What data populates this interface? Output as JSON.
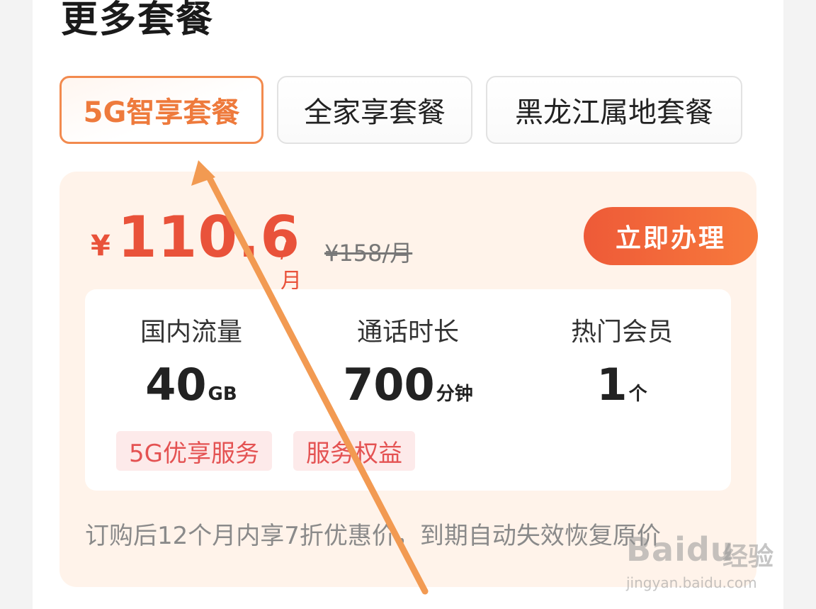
{
  "section": {
    "title": "更多套餐"
  },
  "tabs": [
    {
      "label": "5G智享套餐",
      "active": true
    },
    {
      "label": "全家享套餐",
      "active": false
    },
    {
      "label": "黑龙江属地套餐",
      "active": false
    }
  ],
  "plan": {
    "currency": "¥",
    "price": "110.6",
    "per_month": "/月",
    "original_price": "¥158/月",
    "apply_label": "立即办理",
    "stats": [
      {
        "label": "国内流量",
        "value": "40",
        "unit": "GB"
      },
      {
        "label": "通话时长",
        "value": "700",
        "unit": "分钟"
      },
      {
        "label": "热门会员",
        "value": "1",
        "unit": "个"
      }
    ],
    "tags": [
      "5G优享服务",
      "服务权益"
    ],
    "note": "订购后12个月内享7折优惠价，到期自动失效恢复原价"
  },
  "watermark": {
    "brand": "Baidu",
    "cn": "经验",
    "url": "jingyan.baidu.com"
  },
  "colors": {
    "accent": "#e9523a",
    "tab_active": "#f28a4e",
    "card_bg": "#fff3ea",
    "arrow": "#f29a52"
  }
}
